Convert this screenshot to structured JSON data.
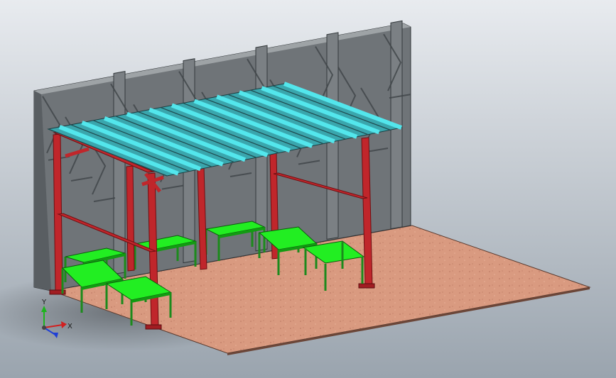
{
  "viewport": {
    "background_top": "#e8ebef",
    "background_bottom": "#9aa4ae"
  },
  "colors": {
    "wall_stone": "#6f7478",
    "wall_joint": "#3e4447",
    "ground": "#d99a80",
    "steel_frame": "#c0262b",
    "roof_panel": "#53e6ec",
    "bench_top": "#22ee22",
    "bench_leg": "#1c8a1c"
  },
  "scene": {
    "objects": [
      {
        "name": "stone-wall",
        "icon": "wall-icon"
      },
      {
        "name": "ground-slab",
        "icon": "slab-icon"
      },
      {
        "name": "steel-frame",
        "icon": "frame-icon"
      },
      {
        "name": "corrugated-roof",
        "icon": "roof-icon"
      },
      {
        "name": "bench-1",
        "icon": "bench-icon"
      },
      {
        "name": "bench-2",
        "icon": "bench-icon"
      },
      {
        "name": "bench-3",
        "icon": "bench-icon"
      },
      {
        "name": "bench-4",
        "icon": "bench-icon"
      },
      {
        "name": "bench-5",
        "icon": "bench-icon"
      },
      {
        "name": "bench-6",
        "icon": "bench-icon"
      }
    ]
  },
  "triad": {
    "y_label": "Y",
    "x_label": "X",
    "y_color": "#1db51d",
    "x_color": "#d12020",
    "z_color": "#1f3fd6"
  }
}
